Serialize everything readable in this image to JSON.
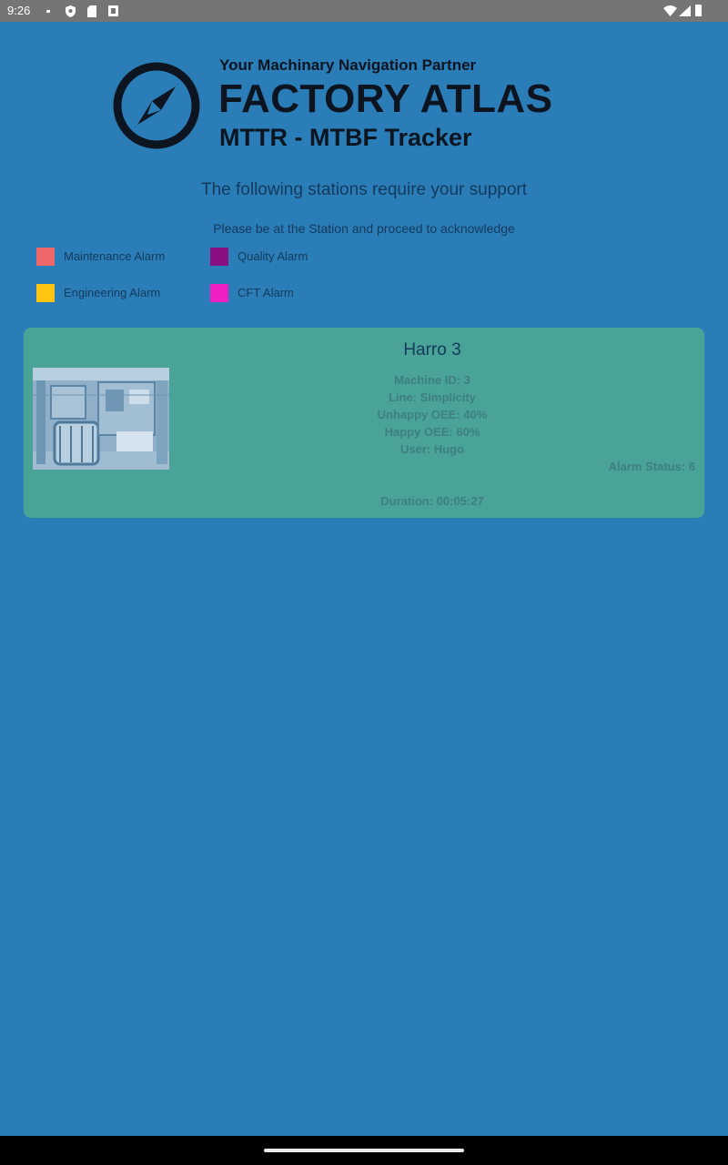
{
  "status_bar": {
    "time": "9:26",
    "icons": [
      "notification-dot-icon",
      "shield-icon",
      "sd-card-icon",
      "box-icon",
      "wifi-icon",
      "signal-icon",
      "battery-icon"
    ]
  },
  "header": {
    "tagline": "Your Machinary Navigation Partner",
    "brand": "FACTORY ATLAS",
    "subtitle": "MTTR - MTBF Tracker",
    "logo_icon": "compass-icon"
  },
  "main": {
    "heading": "The following stations require your support",
    "instruction": "Please be at the Station and proceed to acknowledge"
  },
  "legend": [
    {
      "label": "Maintenance Alarm",
      "color": "#f0676b"
    },
    {
      "label": "Quality Alarm",
      "color": "#8a0f82"
    },
    {
      "label": "Engineering Alarm",
      "color": "#fec513"
    },
    {
      "label": "CFT Alarm",
      "color": "#f01fc4"
    }
  ],
  "station_card": {
    "color": "#4aa397",
    "title": "Harro 3",
    "machine_id": "Machine ID: 3",
    "line": "Line: Simplicity",
    "unhappy_oee": "Unhappy OEE: 40%",
    "happy_oee": "Happy OEE: 60%",
    "user": "User: Hugo",
    "alarm_status": "Alarm Status: 6",
    "duration": "Duration: 00:05:27"
  },
  "colors": {
    "background": "#2b7db8",
    "status_bar": "#757575",
    "nav_bar": "#000000"
  }
}
